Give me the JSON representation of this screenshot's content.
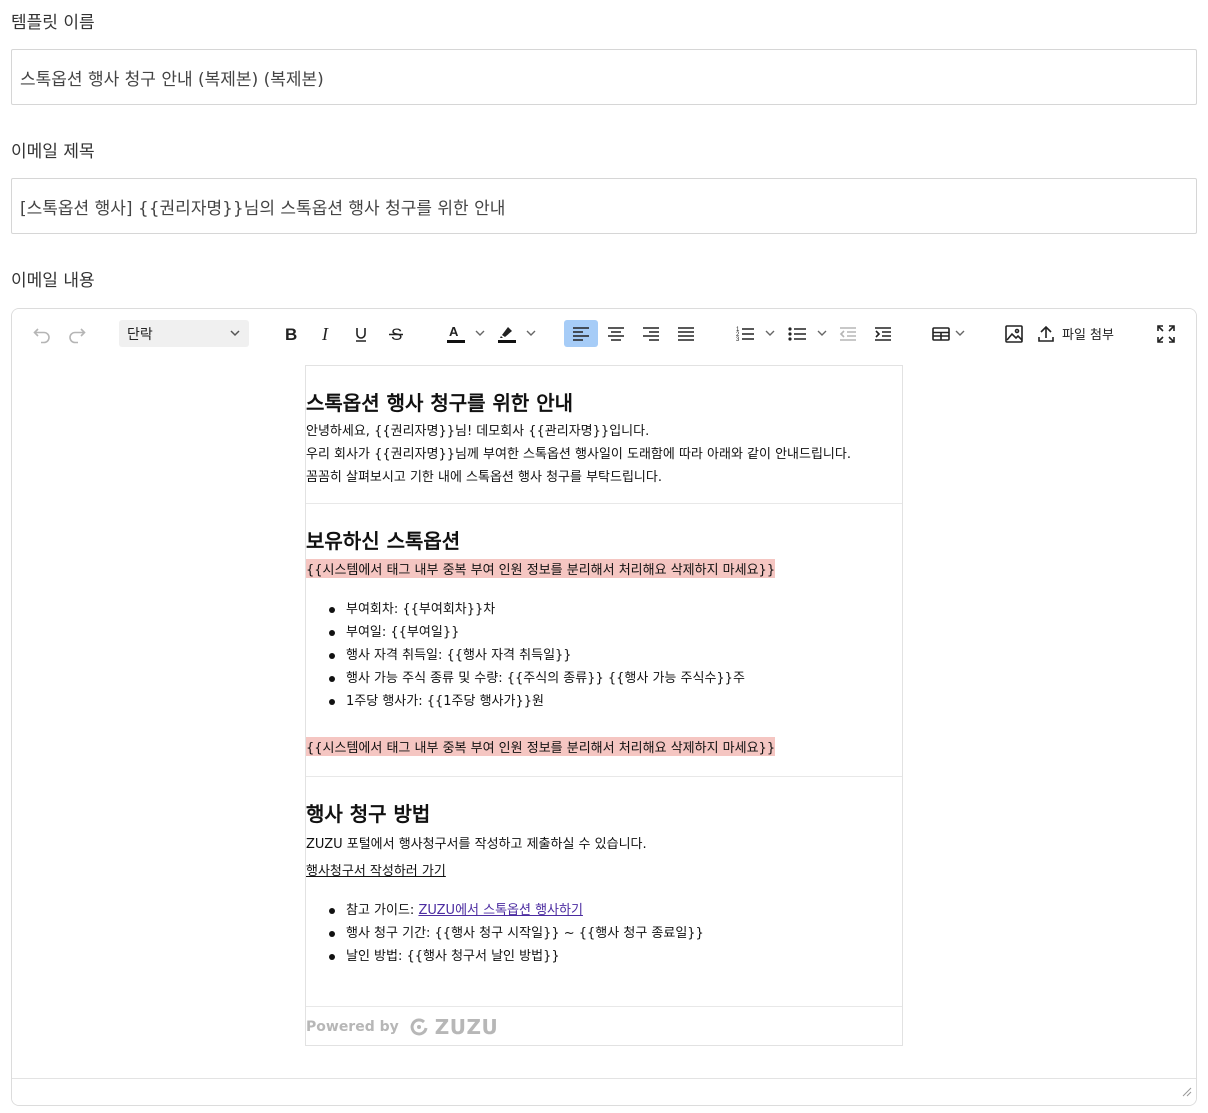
{
  "form": {
    "template_name_label": "템플릿 이름",
    "template_name_value": "스톡옵션 행사 청구 안내 (복제본) (복제본)",
    "subject_label": "이메일 제목",
    "subject_value": "[스톡옵션 행사] {{권리자명}}님의 스톡옵션 행사 청구를 위한 안내",
    "body_label": "이메일 내용"
  },
  "toolbar": {
    "undo_icon": "undo-icon",
    "redo_icon": "redo-icon",
    "block_format": "단락",
    "attach_label": "파일 첨부",
    "active_color": "#a6ccf7"
  },
  "email": {
    "intro": {
      "heading": "스톡옵션 행사 청구를 위한 안내",
      "line1": "안녕하세요, {{권리자명}}님! 데모회사 {{관리자명}}입니다.",
      "line2": "우리 회사가 {{권리자명}}님께 부여한 스톡옵션 행사일이 도래함에 따라 아래와 같이 안내드립니다.",
      "line3": "꼼꼼히 살펴보시고 기한 내에 스톡옵션 행사 청구를 부탁드립니다."
    },
    "options": {
      "heading": "보유하신 스톡옵션",
      "tag_top": "{{시스템에서 태그 내부 중복 부여 인원 정보를 분리해서 처리해요 삭제하지 마세요}}",
      "items": [
        "부여회차: {{부여회차}}차",
        "부여일: {{부여일}}",
        "행사 자격 취득일: {{행사 자격 취득일}}",
        "행사 가능 주식 종류 및 수량: {{주식의 종류}} {{행사 가능 주식수}}주",
        "1주당 행사가: {{1주당 행사가}}원"
      ],
      "tag_bottom": "{{시스템에서 태그 내부 중복 부여 인원 정보를 분리해서 처리해요 삭제하지 마세요}}",
      "highlight_color": "#f5c6c2"
    },
    "method": {
      "heading": "행사 청구 방법",
      "desc": "ZUZU 포털에서 행사청구서를 작성하고 제출하실 수 있습니다.",
      "cta_link": "행사청구서 작성하러 가기",
      "guide_prefix": "참고 가이드: ",
      "guide_link": "ZUZU에서 스톡옵션 행사하기",
      "items": [
        "행사 청구 기간: {{행사 청구 시작일}} ~ {{행사 청구 종료일}}",
        "날인 방법: {{행사 청구서 날인 방법}}"
      ]
    },
    "footer": {
      "powered_by": "Powered by",
      "brand": "ZUZU"
    }
  }
}
